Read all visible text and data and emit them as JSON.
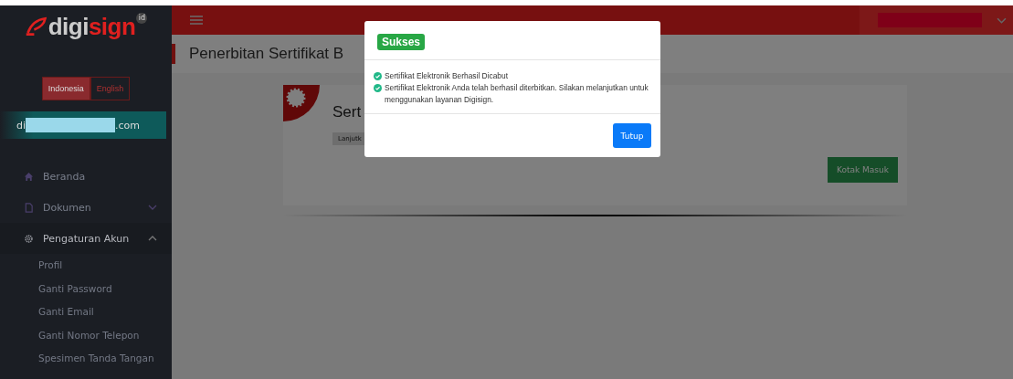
{
  "sidebar": {
    "logo": {
      "prefix": "digi",
      "suffix": "sign",
      "mark": "id"
    },
    "languages": [
      {
        "label": "Indonesia",
        "selected": true
      },
      {
        "label": "English",
        "selected": false
      }
    ],
    "account": {
      "prefix": "di",
      "suffix": ".com"
    },
    "items": [
      {
        "label": "Beranda",
        "expanded": false
      },
      {
        "label": "Dokumen",
        "expanded": false
      },
      {
        "label": "Pengaturan Akun",
        "expanded": true,
        "children": [
          {
            "label": "Profil"
          },
          {
            "label": "Ganti Password"
          },
          {
            "label": "Ganti Email"
          },
          {
            "label": "Ganti Nomor Telepon"
          },
          {
            "label": "Spesimen Tanda Tangan"
          }
        ]
      }
    ]
  },
  "page": {
    "title": "Penerbitan Sertifikat B",
    "card": {
      "title": "Sert",
      "tag": "Lanjutk",
      "button": "Kotak Masuk"
    }
  },
  "modal": {
    "badge": "Sukses",
    "messages": [
      "Sertifikat Elektronik Berhasil Dicabut",
      "Sertifikat Elektronik Anda telah berhasil diterbitkan. Silakan melanjutkan untuk menggunakan layanan Digisign."
    ],
    "button": "Tutup"
  }
}
